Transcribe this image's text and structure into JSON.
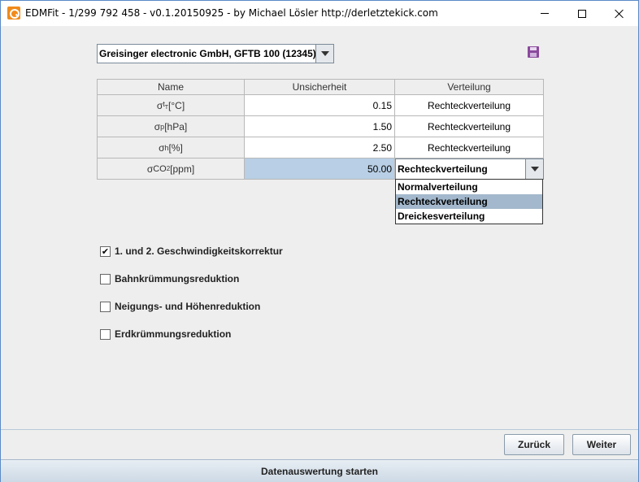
{
  "window": {
    "title": "EDMFit - 1/299 792 458 - v0.1.20150925 - by Michael Lösler http://derletztekick.com"
  },
  "device": {
    "selected": "Greisinger electronic GmbH, GFTB 100 (12345)"
  },
  "table": {
    "headers": [
      "Name",
      "Unsicherheit",
      "Verteilung"
    ],
    "rows": [
      {
        "name_main": "σ",
        "name_sub": "t",
        "name_sub2": "T",
        "name_unit": " [°C]",
        "uncertainty": "0.15",
        "distribution": "Rechteckverteilung"
      },
      {
        "name_main": "σ",
        "name_sub": "p",
        "name_unit": " [hPa]",
        "uncertainty": "1.50",
        "distribution": "Rechteckverteilung"
      },
      {
        "name_main": "σ",
        "name_sub": "h",
        "name_unit": " [%]",
        "uncertainty": "2.50",
        "distribution": "Rechteckverteilung"
      },
      {
        "name_main": "σ",
        "name_sub": "CO",
        "name_sub2": "2",
        "name_unit": " [ppm]",
        "uncertainty": "50.00",
        "distribution": "Rechteckverteilung"
      }
    ]
  },
  "dropdown": {
    "options": [
      "Normalverteilung",
      "Rechteckverteilung",
      "Dreickesverteilung"
    ],
    "selected_index": 1
  },
  "options": [
    {
      "label": "1. und 2. Geschwindigkeitskorrektur",
      "checked": true
    },
    {
      "label": "Bahnkrümmungsreduktion",
      "checked": false
    },
    {
      "label": "Neigungs- und Höhenreduktion",
      "checked": false
    },
    {
      "label": "Erdkrümmungsreduktion",
      "checked": false
    }
  ],
  "buttons": {
    "back": "Zurück",
    "next": "Weiter",
    "start": "Datenauswertung starten"
  },
  "colors": {
    "selected_cell": "#b8cfe5",
    "selected_option": "#a3b8cc",
    "window_border": "#5a8ac6"
  }
}
